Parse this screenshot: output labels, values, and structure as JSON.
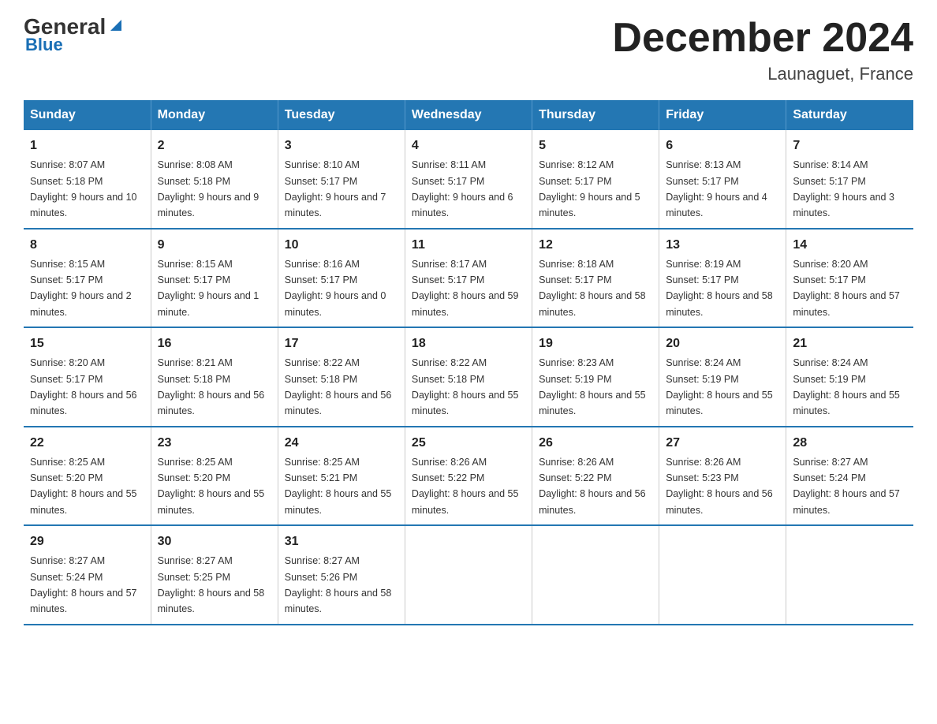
{
  "logo": {
    "general": "General",
    "blue": "Blue"
  },
  "header": {
    "title": "December 2024",
    "location": "Launaguet, France"
  },
  "weekdays": [
    "Sunday",
    "Monday",
    "Tuesday",
    "Wednesday",
    "Thursday",
    "Friday",
    "Saturday"
  ],
  "weeks": [
    [
      {
        "day": "1",
        "sunrise": "8:07 AM",
        "sunset": "5:18 PM",
        "daylight": "9 hours and 10 minutes."
      },
      {
        "day": "2",
        "sunrise": "8:08 AM",
        "sunset": "5:18 PM",
        "daylight": "9 hours and 9 minutes."
      },
      {
        "day": "3",
        "sunrise": "8:10 AM",
        "sunset": "5:17 PM",
        "daylight": "9 hours and 7 minutes."
      },
      {
        "day": "4",
        "sunrise": "8:11 AM",
        "sunset": "5:17 PM",
        "daylight": "9 hours and 6 minutes."
      },
      {
        "day": "5",
        "sunrise": "8:12 AM",
        "sunset": "5:17 PM",
        "daylight": "9 hours and 5 minutes."
      },
      {
        "day": "6",
        "sunrise": "8:13 AM",
        "sunset": "5:17 PM",
        "daylight": "9 hours and 4 minutes."
      },
      {
        "day": "7",
        "sunrise": "8:14 AM",
        "sunset": "5:17 PM",
        "daylight": "9 hours and 3 minutes."
      }
    ],
    [
      {
        "day": "8",
        "sunrise": "8:15 AM",
        "sunset": "5:17 PM",
        "daylight": "9 hours and 2 minutes."
      },
      {
        "day": "9",
        "sunrise": "8:15 AM",
        "sunset": "5:17 PM",
        "daylight": "9 hours and 1 minute."
      },
      {
        "day": "10",
        "sunrise": "8:16 AM",
        "sunset": "5:17 PM",
        "daylight": "9 hours and 0 minutes."
      },
      {
        "day": "11",
        "sunrise": "8:17 AM",
        "sunset": "5:17 PM",
        "daylight": "8 hours and 59 minutes."
      },
      {
        "day": "12",
        "sunrise": "8:18 AM",
        "sunset": "5:17 PM",
        "daylight": "8 hours and 58 minutes."
      },
      {
        "day": "13",
        "sunrise": "8:19 AM",
        "sunset": "5:17 PM",
        "daylight": "8 hours and 58 minutes."
      },
      {
        "day": "14",
        "sunrise": "8:20 AM",
        "sunset": "5:17 PM",
        "daylight": "8 hours and 57 minutes."
      }
    ],
    [
      {
        "day": "15",
        "sunrise": "8:20 AM",
        "sunset": "5:17 PM",
        "daylight": "8 hours and 56 minutes."
      },
      {
        "day": "16",
        "sunrise": "8:21 AM",
        "sunset": "5:18 PM",
        "daylight": "8 hours and 56 minutes."
      },
      {
        "day": "17",
        "sunrise": "8:22 AM",
        "sunset": "5:18 PM",
        "daylight": "8 hours and 56 minutes."
      },
      {
        "day": "18",
        "sunrise": "8:22 AM",
        "sunset": "5:18 PM",
        "daylight": "8 hours and 55 minutes."
      },
      {
        "day": "19",
        "sunrise": "8:23 AM",
        "sunset": "5:19 PM",
        "daylight": "8 hours and 55 minutes."
      },
      {
        "day": "20",
        "sunrise": "8:24 AM",
        "sunset": "5:19 PM",
        "daylight": "8 hours and 55 minutes."
      },
      {
        "day": "21",
        "sunrise": "8:24 AM",
        "sunset": "5:19 PM",
        "daylight": "8 hours and 55 minutes."
      }
    ],
    [
      {
        "day": "22",
        "sunrise": "8:25 AM",
        "sunset": "5:20 PM",
        "daylight": "8 hours and 55 minutes."
      },
      {
        "day": "23",
        "sunrise": "8:25 AM",
        "sunset": "5:20 PM",
        "daylight": "8 hours and 55 minutes."
      },
      {
        "day": "24",
        "sunrise": "8:25 AM",
        "sunset": "5:21 PM",
        "daylight": "8 hours and 55 minutes."
      },
      {
        "day": "25",
        "sunrise": "8:26 AM",
        "sunset": "5:22 PM",
        "daylight": "8 hours and 55 minutes."
      },
      {
        "day": "26",
        "sunrise": "8:26 AM",
        "sunset": "5:22 PM",
        "daylight": "8 hours and 56 minutes."
      },
      {
        "day": "27",
        "sunrise": "8:26 AM",
        "sunset": "5:23 PM",
        "daylight": "8 hours and 56 minutes."
      },
      {
        "day": "28",
        "sunrise": "8:27 AM",
        "sunset": "5:24 PM",
        "daylight": "8 hours and 57 minutes."
      }
    ],
    [
      {
        "day": "29",
        "sunrise": "8:27 AM",
        "sunset": "5:24 PM",
        "daylight": "8 hours and 57 minutes."
      },
      {
        "day": "30",
        "sunrise": "8:27 AM",
        "sunset": "5:25 PM",
        "daylight": "8 hours and 58 minutes."
      },
      {
        "day": "31",
        "sunrise": "8:27 AM",
        "sunset": "5:26 PM",
        "daylight": "8 hours and 58 minutes."
      },
      null,
      null,
      null,
      null
    ]
  ],
  "labels": {
    "sunrise": "Sunrise:",
    "sunset": "Sunset:",
    "daylight": "Daylight:"
  }
}
